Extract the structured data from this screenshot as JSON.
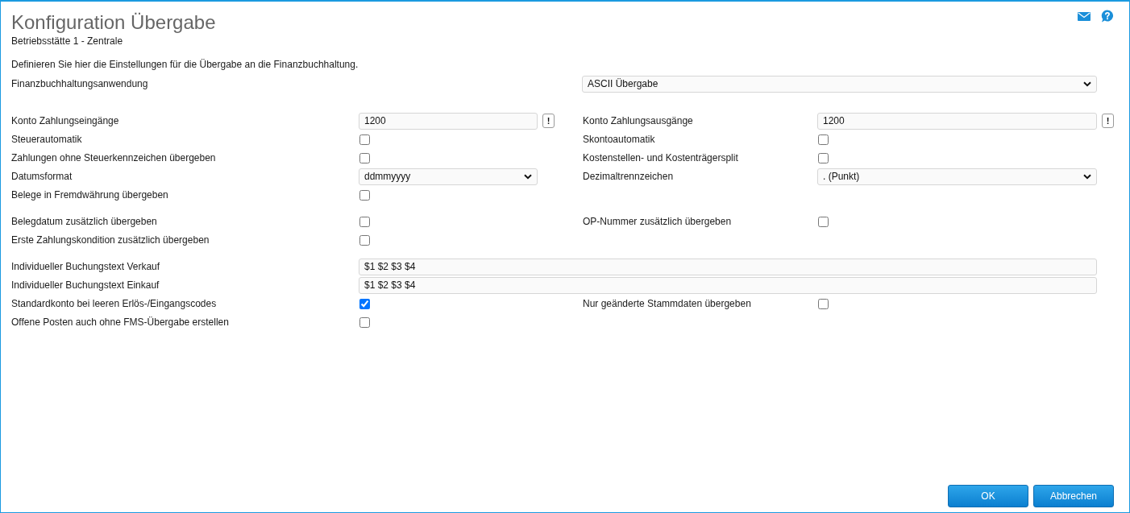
{
  "window": {
    "title": "Konfiguration Übergabe",
    "subtitle": "Betriebsstätte 1 - Zentrale"
  },
  "description": "Definieren Sie hier die Einstellungen für die Übergabe an die Finanzbuchhaltung.",
  "groups": [
    {
      "rows": [
        {
          "kind": "wide-select",
          "label": "Finanzbuchhaltungsanwendung",
          "value": "ASCII Übergabe"
        }
      ]
    },
    {
      "rows": [
        {
          "kind": "pair",
          "left": {
            "kind": "text",
            "label": "Konto Zahlungseingänge",
            "value": "1200",
            "info_button": "!"
          },
          "right": {
            "kind": "text",
            "label": "Konto Zahlungsausgänge",
            "value": "1200",
            "info_button": "!"
          }
        },
        {
          "kind": "pair",
          "left": {
            "kind": "checkbox",
            "label": "Steuerautomatik",
            "checked": false
          },
          "right": {
            "kind": "checkbox",
            "label": "Skontoautomatik",
            "checked": false
          }
        },
        {
          "kind": "pair",
          "left": {
            "kind": "checkbox",
            "label": "Zahlungen ohne Steuerkennzeichen übergeben",
            "checked": false
          },
          "right": {
            "kind": "checkbox",
            "label": "Kostenstellen- und Kostenträgersplit",
            "checked": false
          }
        },
        {
          "kind": "pair",
          "left": {
            "kind": "select",
            "label": "Datumsformat",
            "value": "ddmmyyyy"
          },
          "right": {
            "kind": "select",
            "label": "Dezimaltrennzeichen",
            "value": ". (Punkt)"
          }
        },
        {
          "kind": "pair",
          "left": {
            "kind": "checkbox",
            "label": "Belege in Fremdwährung übergeben",
            "checked": false
          }
        }
      ]
    },
    {
      "rows": [
        {
          "kind": "pair",
          "left": {
            "kind": "checkbox",
            "label": "Belegdatum zusätzlich übergeben",
            "checked": false
          },
          "right": {
            "kind": "checkbox",
            "label": "OP-Nummer zusätzlich übergeben",
            "checked": false
          }
        },
        {
          "kind": "pair",
          "left": {
            "kind": "checkbox",
            "label": "Erste Zahlungskondition zusätzlich übergeben",
            "checked": false
          }
        }
      ]
    },
    {
      "rows": [
        {
          "kind": "wide-text",
          "label": "Individueller Buchungstext Verkauf",
          "value": "$1 $2 $3 $4"
        },
        {
          "kind": "wide-text",
          "label": "Individueller Buchungstext Einkauf",
          "value": "$1 $2 $3 $4"
        },
        {
          "kind": "pair",
          "left": {
            "kind": "checkbox",
            "label": "Standardkonto bei leeren Erlös-/Eingangscodes",
            "checked": true
          },
          "right": {
            "kind": "checkbox",
            "label": "Nur geänderte Stammdaten übergeben",
            "checked": false
          }
        },
        {
          "kind": "pair",
          "left": {
            "kind": "checkbox",
            "label": "Offene Posten auch ohne FMS-Übergabe erstellen",
            "checked": false
          }
        }
      ]
    }
  ],
  "buttons": [
    {
      "label": "OK"
    },
    {
      "label": "Abbrechen"
    }
  ]
}
